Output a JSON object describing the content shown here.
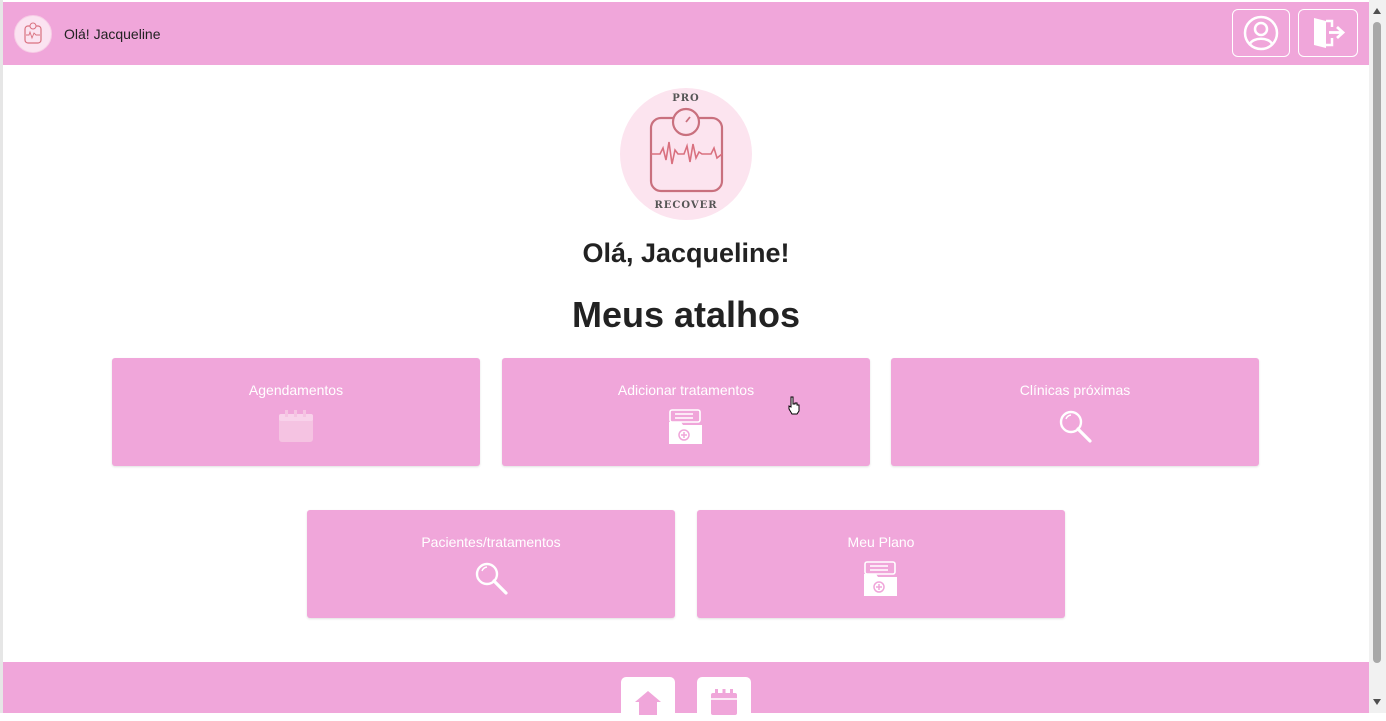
{
  "header": {
    "greeting": "Olá! Jacqueline",
    "profile_icon": "user-circle-icon",
    "logout_icon": "door-exit-icon"
  },
  "logo": {
    "top_text": "PRO",
    "bottom_text": "RECOVER"
  },
  "main": {
    "greeting": "Olá, Jacqueline!",
    "section_title": "Meus atalhos",
    "shortcuts": [
      {
        "label": "Agendamentos",
        "icon": "calendar-icon"
      },
      {
        "label": "Adicionar tratamentos",
        "icon": "medical-folder-icon"
      },
      {
        "label": "Clínicas próximas",
        "icon": "search-icon"
      },
      {
        "label": "Pacientes/tratamentos",
        "icon": "search-icon"
      },
      {
        "label": "Meu Plano",
        "icon": "medical-folder-icon"
      }
    ]
  },
  "footer": {
    "items": [
      {
        "icon": "home-icon"
      },
      {
        "icon": "calendar-icon"
      }
    ]
  },
  "colors": {
    "brand_pink": "#f0a6da",
    "logo_bg": "#fce4ef",
    "accent_rose": "#d9707f"
  }
}
